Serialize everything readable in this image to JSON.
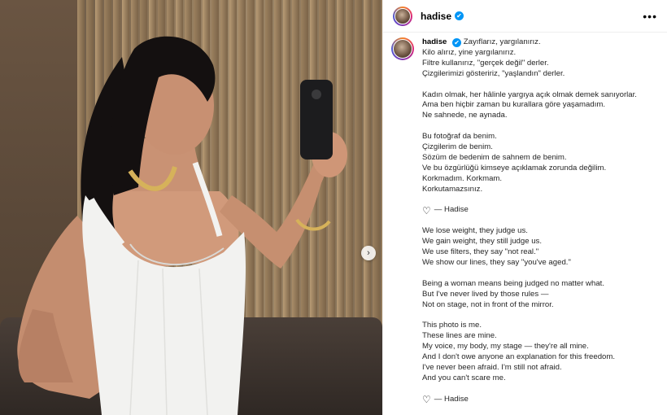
{
  "post": {
    "username": "hadise",
    "verified_glyph": "✔",
    "more_glyph": "•••",
    "next_glyph": "›"
  },
  "caption": {
    "first_line": "Zayıflarız, yargılanırız.",
    "lines_tr_1": [
      "Kilo alırız, yine yargılanırız.",
      "Filtre kullanırız, \"gerçek değil\" derler.",
      "Çizgilerimizi gösteririz, \"yaşlandın\" derler."
    ],
    "lines_tr_2": [
      "Kadın olmak, her hâlinle yargıya açık olmak demek sanıyorlar.",
      "Ama ben hiçbir zaman bu kurallara göre yaşamadım.",
      "Ne sahnede, ne aynada."
    ],
    "lines_tr_3": [
      "Bu fotoğraf da benim.",
      "Çizgilerim de benim.",
      "Sözüm de bedenim de sahnem de benim.",
      "Ve bu özgürlüğü kimseye açıklamak zorunda değilim.",
      "Korkmadım. Korkmam.",
      "Korkutamazsınız."
    ],
    "signature_tr": "— Hadise",
    "lines_en_1": [
      "We lose weight, they judge us.",
      "We gain weight, they still judge us.",
      "We use filters, they say \"not real.\"",
      "We show our lines, they say \"you've aged.\""
    ],
    "lines_en_2": [
      "Being a woman means being judged no matter what.",
      "But I've never lived by those rules —",
      "Not on stage, not in front of the mirror."
    ],
    "lines_en_3": [
      "This photo is me.",
      "These lines are mine.",
      "My voice, my body, my stage — they're all mine.",
      "And I don't owe anyone an explanation for this freedom.",
      "I've never been afraid. I'm still not afraid.",
      "And you can't scare me."
    ],
    "signature_en": "— Hadise",
    "heart_glyph": "♡"
  },
  "colors": {
    "verified": "#0095f6",
    "dress": "#f2f2f0",
    "hair": "#141010"
  }
}
